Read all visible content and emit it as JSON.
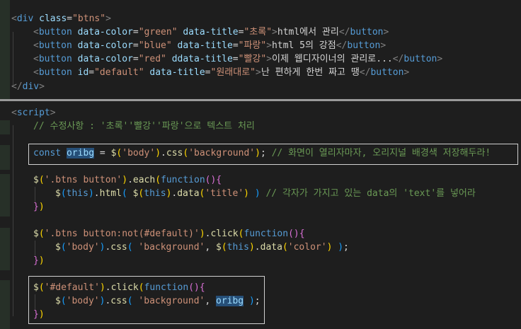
{
  "html_block": {
    "line1": {
      "open": "<",
      "tag": "div",
      "attr": "class",
      "eq": "=",
      "val": "\"btns\"",
      "close": ">"
    },
    "button_lines": [
      {
        "attr1": "data-color",
        "val1": "\"green\"",
        "attr2": "data-title",
        "val2": "\"초록\"",
        "text": "html에서 관리"
      },
      {
        "attr1": "data-color",
        "val1": "\"blue\"",
        "attr2": "data-title",
        "val2": "\"파랑\"",
        "text": "html 5의 강점"
      },
      {
        "attr1": "data-color",
        "val1": "\"red\"",
        "attr2": "ddata-title",
        "val2": "\"빨강\"",
        "text": "이제 웹디자이너의 관리로..."
      },
      {
        "attr1": "id",
        "val1": "\"default\"",
        "attr2": "data-title",
        "val2": "\"원래대로\"",
        "text": "난 편하게 한번 짜고 땡"
      }
    ],
    "button_tag": "button",
    "close_div": "div"
  },
  "script_block": {
    "script_tag": "script",
    "comment_korean": "// 수정사항 : '초록''빨강''파랑'으로 텍스트 처리",
    "oribg_line": {
      "kw": "const",
      "var": "oribg",
      "eq": " = ",
      "fn": "$",
      "selector": "'body'",
      "method": "css",
      "arg": "'background'",
      "comment": "// 화면이 열리자마자, 오리지널 배경색 저장해두라!"
    },
    "each_block": {
      "selector": "'.btns button'",
      "method": "each",
      "kw": "function",
      "inner_html": "html",
      "inner_this": "this",
      "inner_data": "data",
      "inner_arg": "'title'",
      "comment": "// 각자가 가지고 있는 data의 'text'를 넣어라"
    },
    "click_block": {
      "selector": "'.btns button:not(#default)'",
      "method": "click",
      "kw": "function",
      "sel2": "'body'",
      "css": "css",
      "arg1": "'background'",
      "this": "this",
      "data": "data",
      "arg2": "'color'"
    },
    "default_block": {
      "selector": "'#default'",
      "method": "click",
      "kw": "function",
      "sel2": "'body'",
      "css": "css",
      "arg1": "'background'",
      "var": "oribg"
    }
  },
  "colors": {
    "background": "#1e1e1e",
    "tag": "#569cd6",
    "attribute": "#9cdcfe",
    "string": "#ce9178",
    "comment": "#6a9955",
    "function": "#dcdcaa",
    "bracket1": "#ffd700",
    "bracket2": "#da70d6",
    "bracket3": "#179fff"
  }
}
